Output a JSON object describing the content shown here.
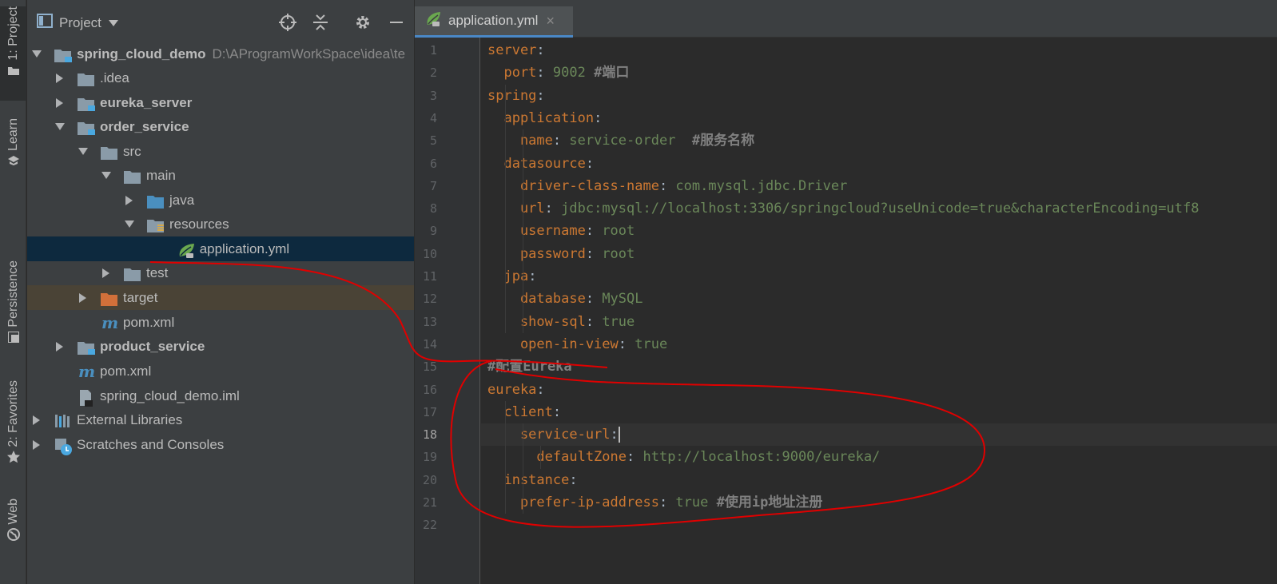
{
  "strip": {
    "items": [
      {
        "label": "1: Project",
        "icon": "folder-icon"
      },
      {
        "label": "Learn",
        "icon": "learn-icon"
      },
      {
        "label": "Persistence",
        "icon": "persistence-icon"
      },
      {
        "label": "2: Favorites",
        "icon": "star-icon"
      },
      {
        "label": "Web",
        "icon": "globe-icon"
      }
    ]
  },
  "project": {
    "title": "Project",
    "tree": [
      {
        "label": "spring_cloud_demo",
        "extra": "D:\\AProgramWorkSpace\\idea\\te",
        "icon": "module-folder-icon",
        "bold": true
      },
      {
        "label": ".idea",
        "icon": "folder-icon"
      },
      {
        "label": "eureka_server",
        "icon": "module-folder-icon",
        "bold": true
      },
      {
        "label": "order_service",
        "icon": "module-folder-icon",
        "bold": true
      },
      {
        "label": "src",
        "icon": "folder-icon"
      },
      {
        "label": "main",
        "icon": "folder-icon"
      },
      {
        "label": "java",
        "icon": "source-folder-icon"
      },
      {
        "label": "resources",
        "icon": "resources-folder-icon"
      },
      {
        "label": "application.yml",
        "icon": "spring-leaf-icon"
      },
      {
        "label": "test",
        "icon": "folder-icon"
      },
      {
        "label": "target",
        "icon": "excluded-folder-icon"
      },
      {
        "label": "pom.xml",
        "icon": "maven-icon"
      },
      {
        "label": "product_service",
        "icon": "module-folder-icon",
        "bold": true
      },
      {
        "label": "pom.xml",
        "icon": "maven-icon"
      },
      {
        "label": "spring_cloud_demo.iml",
        "icon": "iml-file-icon"
      },
      {
        "label": "External Libraries",
        "icon": "libraries-icon"
      },
      {
        "label": "Scratches and Consoles",
        "icon": "scratches-icon"
      }
    ]
  },
  "editor": {
    "tab": {
      "label": "application.yml",
      "icon": "spring-leaf-icon"
    },
    "current_line": "18",
    "lines": [
      {
        "n": "1",
        "parts": [
          {
            "t": "server",
            "c": "k"
          },
          {
            "t": ":",
            "c": "p"
          }
        ]
      },
      {
        "n": "2",
        "parts": [
          {
            "t": "  port",
            "c": "k"
          },
          {
            "t": ": ",
            "c": "p"
          },
          {
            "t": "9002 ",
            "c": "v"
          },
          {
            "t": "#端口",
            "c": "c"
          }
        ]
      },
      {
        "n": "3",
        "parts": [
          {
            "t": "spring",
            "c": "k"
          },
          {
            "t": ":",
            "c": "p"
          }
        ]
      },
      {
        "n": "4",
        "parts": [
          {
            "t": "  application",
            "c": "k"
          },
          {
            "t": ":",
            "c": "p"
          }
        ]
      },
      {
        "n": "5",
        "parts": [
          {
            "t": "    name",
            "c": "k"
          },
          {
            "t": ": ",
            "c": "p"
          },
          {
            "t": "service-order  ",
            "c": "v"
          },
          {
            "t": "#服务名称",
            "c": "c"
          }
        ]
      },
      {
        "n": "6",
        "parts": [
          {
            "t": "  datasource",
            "c": "k"
          },
          {
            "t": ":",
            "c": "p"
          }
        ]
      },
      {
        "n": "7",
        "parts": [
          {
            "t": "    driver-class-name",
            "c": "k"
          },
          {
            "t": ": ",
            "c": "p"
          },
          {
            "t": "com.mysql.jdbc.Driver",
            "c": "v"
          }
        ]
      },
      {
        "n": "8",
        "parts": [
          {
            "t": "    url",
            "c": "k"
          },
          {
            "t": ": ",
            "c": "p"
          },
          {
            "t": "jdbc:mysql://localhost:3306/springcloud?useUnicode=true&characterEncoding=utf8",
            "c": "v"
          }
        ]
      },
      {
        "n": "9",
        "parts": [
          {
            "t": "    username",
            "c": "k"
          },
          {
            "t": ": ",
            "c": "p"
          },
          {
            "t": "root",
            "c": "v"
          }
        ]
      },
      {
        "n": "10",
        "parts": [
          {
            "t": "    password",
            "c": "k"
          },
          {
            "t": ": ",
            "c": "p"
          },
          {
            "t": "root",
            "c": "v"
          }
        ]
      },
      {
        "n": "11",
        "parts": [
          {
            "t": "  jpa",
            "c": "k"
          },
          {
            "t": ":",
            "c": "p"
          }
        ]
      },
      {
        "n": "12",
        "parts": [
          {
            "t": "    database",
            "c": "k"
          },
          {
            "t": ": ",
            "c": "p"
          },
          {
            "t": "MySQL",
            "c": "v"
          }
        ]
      },
      {
        "n": "13",
        "parts": [
          {
            "t": "    show-sql",
            "c": "k"
          },
          {
            "t": ": ",
            "c": "p"
          },
          {
            "t": "true",
            "c": "v"
          }
        ]
      },
      {
        "n": "14",
        "parts": [
          {
            "t": "    open-in-view",
            "c": "k"
          },
          {
            "t": ": ",
            "c": "p"
          },
          {
            "t": "true",
            "c": "v"
          }
        ]
      },
      {
        "n": "15",
        "parts": [
          {
            "t": "#配置Eureka",
            "c": "c"
          }
        ]
      },
      {
        "n": "16",
        "parts": [
          {
            "t": "eureka",
            "c": "k"
          },
          {
            "t": ":",
            "c": "p"
          }
        ]
      },
      {
        "n": "17",
        "parts": [
          {
            "t": "  client",
            "c": "k"
          },
          {
            "t": ":",
            "c": "p"
          }
        ]
      },
      {
        "n": "18",
        "parts": [
          {
            "t": "    service-url",
            "c": "k"
          },
          {
            "t": ":",
            "c": "p"
          }
        ]
      },
      {
        "n": "19",
        "parts": [
          {
            "t": "      defaultZone",
            "c": "k"
          },
          {
            "t": ": ",
            "c": "p"
          },
          {
            "t": "http://localhost:9000/eureka/",
            "c": "v"
          }
        ]
      },
      {
        "n": "20",
        "parts": [
          {
            "t": "  instance",
            "c": "k"
          },
          {
            "t": ":",
            "c": "p"
          }
        ]
      },
      {
        "n": "21",
        "parts": [
          {
            "t": "    prefer-ip-address",
            "c": "k"
          },
          {
            "t": ": ",
            "c": "p"
          },
          {
            "t": "true ",
            "c": "v"
          },
          {
            "t": "#使用ip地址注册",
            "c": "c"
          }
        ]
      },
      {
        "n": "22",
        "parts": []
      }
    ]
  },
  "colors": {
    "keyword": "#cc7832",
    "value": "#6a8759",
    "comment": "#808080",
    "selection": "#0d293e",
    "annotation": "#e00000"
  }
}
